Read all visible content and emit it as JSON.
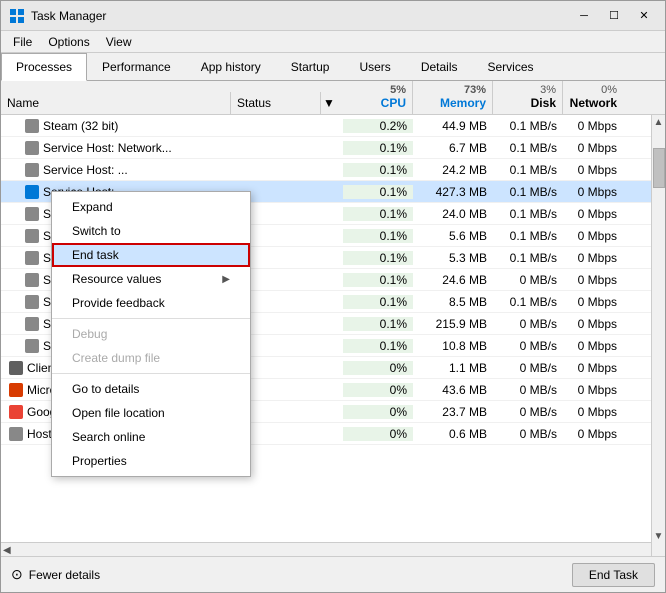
{
  "window": {
    "title": "Task Manager",
    "minimize_label": "─",
    "maximize_label": "☐",
    "close_label": "✕"
  },
  "menu": {
    "items": [
      "File",
      "Options",
      "View"
    ]
  },
  "tabs": [
    {
      "label": "Processes",
      "active": true
    },
    {
      "label": "Performance",
      "active": false
    },
    {
      "label": "App history",
      "active": false
    },
    {
      "label": "Startup",
      "active": false
    },
    {
      "label": "Users",
      "active": false
    },
    {
      "label": "Details",
      "active": false
    },
    {
      "label": "Services",
      "active": false
    }
  ],
  "table": {
    "headers": {
      "name": "Name",
      "status": "Status",
      "cpu_pct": "5%",
      "cpu_label": "CPU",
      "memory_pct": "73%",
      "memory_label": "Memory",
      "disk_pct": "3%",
      "disk_label": "Disk",
      "network_pct": "0%",
      "network_label": "Network"
    },
    "rows": [
      {
        "name": "Steam (32 bit)",
        "status": "",
        "cpu": "0.2%",
        "memory": "44.9 MB",
        "disk": "0.1 MB/s",
        "network": "0 Mbps",
        "indent": true
      },
      {
        "name": "Service Host: Network...",
        "status": "",
        "cpu": "0.1%",
        "memory": "6.7 MB",
        "disk": "0.1 MB/s",
        "network": "0 Mbps",
        "indent": true
      },
      {
        "name": "Service Host: ...",
        "status": "",
        "cpu": "0.1%",
        "memory": "24.2 MB",
        "disk": "0.1 MB/s",
        "network": "0 Mbps",
        "indent": true
      },
      {
        "name": "Service Host: ...",
        "status": "",
        "cpu": "0.1%",
        "memory": "427.3 MB",
        "disk": "0.1 MB/s",
        "network": "0 Mbps",
        "highlighted": true,
        "indent": true
      },
      {
        "name": "Service Host: ...",
        "status": "",
        "cpu": "0.1%",
        "memory": "24.0 MB",
        "disk": "0.1 MB/s",
        "network": "0 Mbps",
        "indent": true
      },
      {
        "name": "Service Host: ...",
        "status": "",
        "cpu": "0.1%",
        "memory": "5.6 MB",
        "disk": "0.1 MB/s",
        "network": "0 Mbps",
        "indent": true
      },
      {
        "name": "Service Host: ...",
        "status": "",
        "cpu": "0.1%",
        "memory": "5.3 MB",
        "disk": "0.1 MB/s",
        "network": "0 Mbps",
        "indent": true
      },
      {
        "name": "Service Host: ...",
        "status": "",
        "cpu": "0.1%",
        "memory": "24.6 MB",
        "disk": "0 MB/s",
        "network": "0 Mbps",
        "indent": true
      },
      {
        "name": "Service Host: ...",
        "status": "",
        "cpu": "0.1%",
        "memory": "8.5 MB",
        "disk": "0.1 MB/s",
        "network": "0 Mbps",
        "indent": true
      },
      {
        "name": "Service Host: ...",
        "status": "",
        "cpu": "0.1%",
        "memory": "215.9 MB",
        "disk": "0 MB/s",
        "network": "0 Mbps",
        "indent": true
      },
      {
        "name": "Service Host: ...",
        "status": "",
        "cpu": "0.1%",
        "memory": "10.8 MB",
        "disk": "0 MB/s",
        "network": "0 Mbps",
        "indent": true
      },
      {
        "name": "Client Server Runtime Process",
        "status": "",
        "cpu": "0%",
        "memory": "1.1 MB",
        "disk": "0 MB/s",
        "network": "0 Mbps",
        "indent": false
      },
      {
        "name": "Microsoft Outlook",
        "status": "",
        "cpu": "0%",
        "memory": "43.6 MB",
        "disk": "0 MB/s",
        "network": "0 Mbps",
        "indent": false
      },
      {
        "name": "Google Chrome",
        "status": "",
        "cpu": "0%",
        "memory": "23.7 MB",
        "disk": "0 MB/s",
        "network": "0 Mbps",
        "indent": false
      },
      {
        "name": "Host Process for Windows Tasks",
        "status": "",
        "cpu": "0%",
        "memory": "0.6 MB",
        "disk": "0 MB/s",
        "network": "0 Mbps",
        "indent": false
      }
    ]
  },
  "context_menu": {
    "items": [
      {
        "label": "Expand",
        "type": "normal"
      },
      {
        "label": "Switch to",
        "type": "normal"
      },
      {
        "label": "End task",
        "type": "highlighted"
      },
      {
        "label": "Resource values",
        "type": "submenu",
        "arrow": "▶"
      },
      {
        "label": "Provide feedback",
        "type": "normal"
      },
      {
        "label": "Debug",
        "type": "disabled"
      },
      {
        "label": "Create dump file",
        "type": "disabled"
      },
      {
        "label": "Go to details",
        "type": "normal"
      },
      {
        "label": "Open file location",
        "type": "normal"
      },
      {
        "label": "Search online",
        "type": "normal"
      },
      {
        "label": "Properties",
        "type": "normal"
      }
    ]
  },
  "footer": {
    "fewer_details": "Fewer details",
    "end_task": "End Task"
  }
}
